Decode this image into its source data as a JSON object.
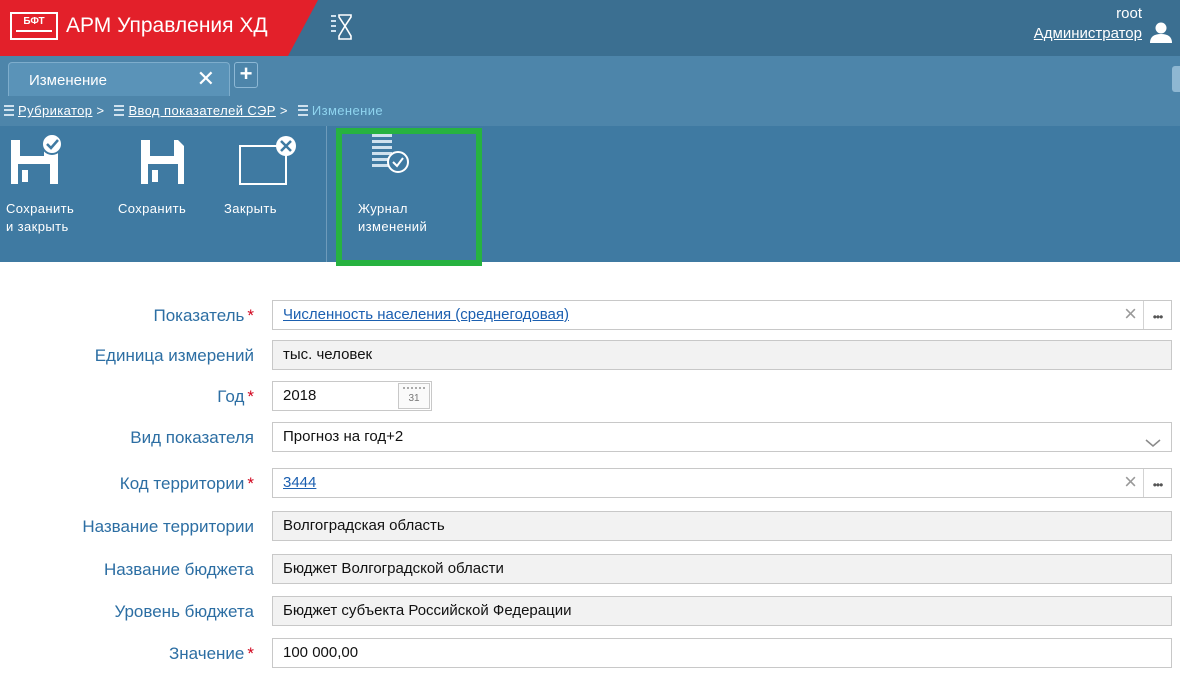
{
  "header": {
    "logo_text": "БФТ",
    "app_title": "АРМ Управления ХД",
    "user_name": "root",
    "user_role": "Администратор"
  },
  "tabs": [
    {
      "label": "Изменение"
    }
  ],
  "breadcrumb": {
    "items": [
      {
        "label": "Рубрикатор"
      },
      {
        "label": "Ввод показателей СЭР"
      },
      {
        "label": "Изменение"
      }
    ]
  },
  "toolbar": {
    "save_close": [
      "Сохранить",
      "и закрыть"
    ],
    "save": "Сохранить",
    "close": "Закрыть",
    "journal": [
      "Журнал",
      "изменений"
    ]
  },
  "form": {
    "indicator": {
      "label": "Показатель",
      "value": "Численность населения (среднегодовая)",
      "required": true
    },
    "unit": {
      "label": "Единица измерений",
      "value": "тыс. человек"
    },
    "year": {
      "label": "Год",
      "value": "2018",
      "required": true,
      "calendar_text": "31"
    },
    "kind": {
      "label": "Вид показателя",
      "value": "Прогноз на год+2"
    },
    "territory_code": {
      "label": "Код территории",
      "value": "3444",
      "required": true
    },
    "territory_name": {
      "label": "Название территории",
      "value": "Волгоградская область"
    },
    "budget_name": {
      "label": "Название бюджета",
      "value": "Бюджет Волгоградской области"
    },
    "budget_level": {
      "label": "Уровень бюджета",
      "value": "Бюджет субъекта Российской Федерации"
    },
    "amount": {
      "label": "Значение",
      "value": "100 000,00",
      "required": true
    }
  },
  "colors": {
    "brand_red": "#e3202a",
    "header_blue": "#3b6f91",
    "label_blue": "#2c6ea3",
    "highlight_green": "#27b240"
  }
}
